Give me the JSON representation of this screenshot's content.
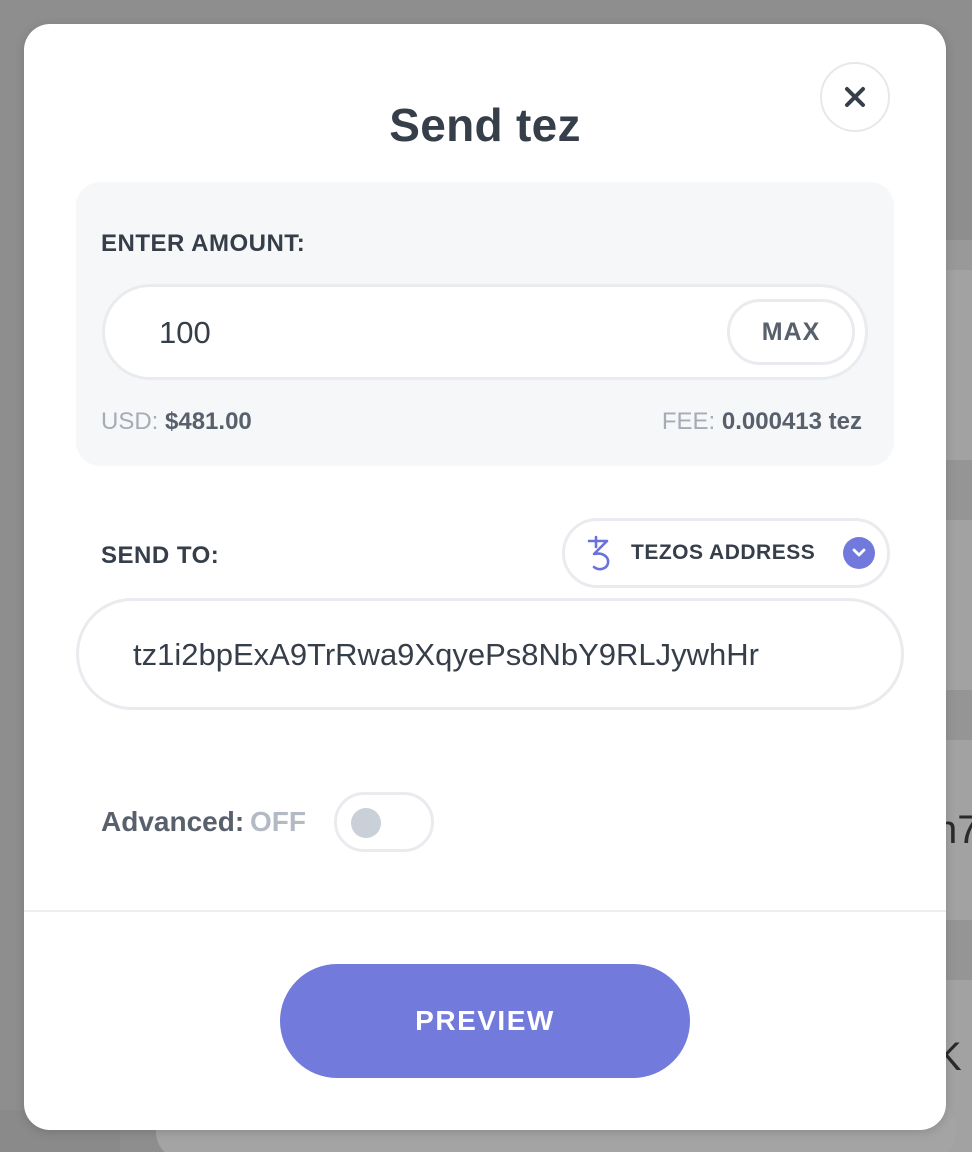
{
  "modal": {
    "title": "Send tez"
  },
  "amount": {
    "label": "ENTER AMOUNT:",
    "value": "100",
    "max_label": "MAX",
    "usd_label": "USD:",
    "usd_value": "$481.00",
    "fee_label": "FEE:",
    "fee_value": "0.000413 tez"
  },
  "send_to": {
    "label": "SEND TO:",
    "address_type": "TEZOS ADDRESS",
    "address_value": "tz1i2bpExA9TrRwa9XqyePs8NbY9RLJywhHr"
  },
  "advanced": {
    "label": "Advanced:",
    "state": "OFF"
  },
  "actions": {
    "preview_label": "PREVIEW"
  },
  "background": {
    "text_1": "n7",
    "text_2": "K"
  },
  "colors": {
    "accent": "#727adb",
    "text_dark": "#363e4a",
    "text_muted": "#a5acb6",
    "panel_bg": "#f6f7f9",
    "border": "#e9ebef"
  }
}
